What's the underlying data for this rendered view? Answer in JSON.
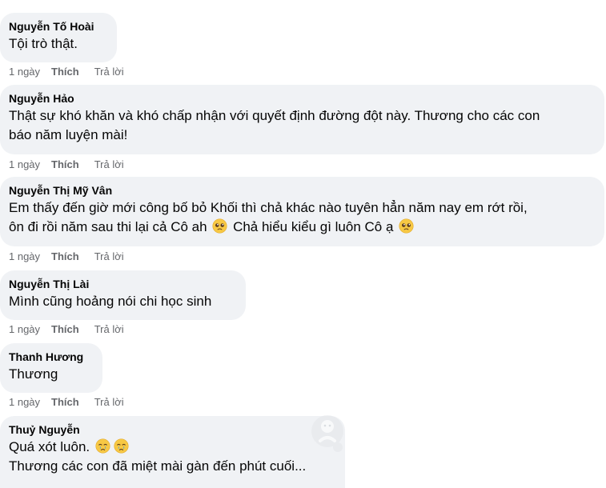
{
  "comments": [
    {
      "author": "Nguyễn Tố Hoài",
      "lines": [
        "Tội trò thật."
      ],
      "time": "1 ngày",
      "like_label": "Thích",
      "reply_label": "Trả lời"
    },
    {
      "author": "Nguyễn Hảo",
      "lines": [
        "Thật sự khó khăn và khó chấp nhận với quyết định đường đột này. Thương cho các con",
        "báo năm luyện mài!"
      ],
      "time": "1 ngày",
      "like_label": "Thích",
      "reply_label": "Trả lời"
    },
    {
      "author": "Nguyễn Thị Mỹ Vân",
      "line1": "Em thấy đến giờ mới công bố bỏ Khối thì chả khác nào tuyên hẳn năm nay em rớt rồi,",
      "line2_a": "ôn đi rồi năm sau thi lại cả Cô ah",
      "line2_b": "Chả hiểu kiểu gì luôn Cô ạ",
      "emoji": "pleading-face-icon",
      "time": "1 ngày",
      "like_label": "Thích",
      "reply_label": "Trả lời"
    },
    {
      "author": "Nguyễn Thị Lài",
      "lines": [
        "Mình cũng hoảng nói chi học sinh"
      ],
      "time": "1 ngày",
      "like_label": "Thích",
      "reply_label": "Trả lời"
    },
    {
      "author": "Thanh Hương",
      "lines": [
        "Thương"
      ],
      "time": "1 ngày",
      "like_label": "Thích",
      "reply_label": "Trả lời"
    },
    {
      "author": "Thuỷ Nguyễn",
      "line1": "Quá xót luôn.",
      "line2": "Thương các con đã miệt mài gàn đến phút cuối...",
      "emoji": "crying-face-icon"
    }
  ],
  "colors": {
    "bubble": "#f0f2f5",
    "text": "#050505",
    "secondary": "#65676b"
  }
}
